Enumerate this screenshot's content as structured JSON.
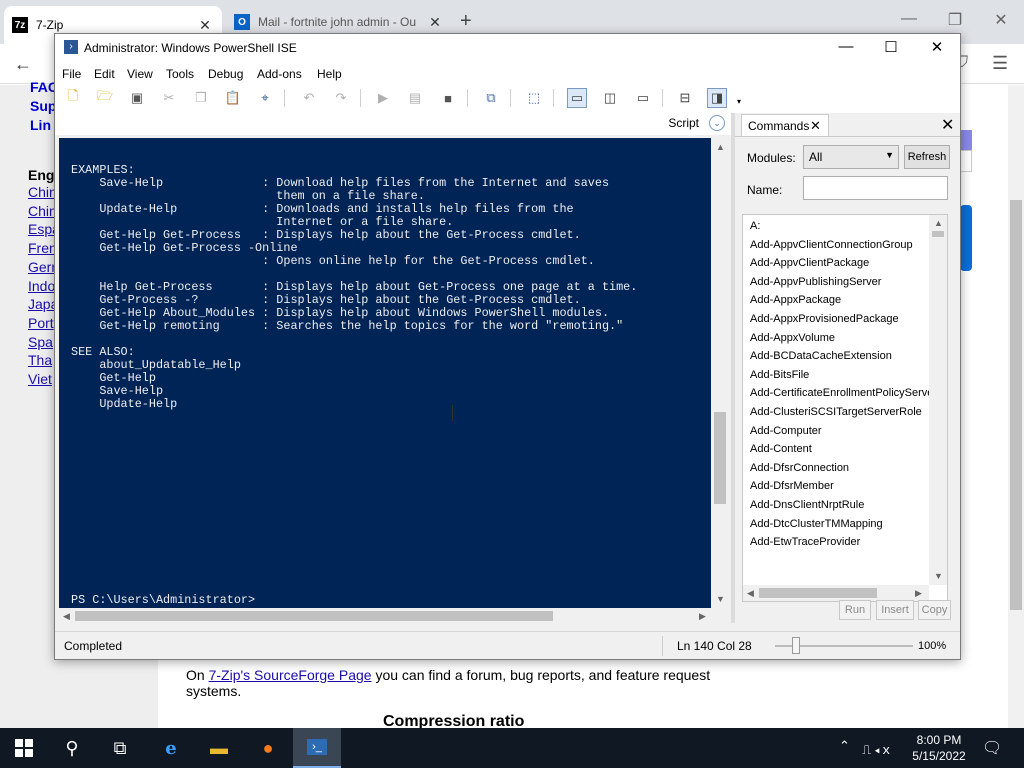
{
  "browser": {
    "tabs": [
      {
        "icon": "7z",
        "title": "7-Zip",
        "close": "✕"
      },
      {
        "icon": "O",
        "title": "Mail - fortnite john admin - Ou",
        "close": "✕"
      }
    ],
    "new_tab": "+",
    "window_controls": {
      "minimize": "—",
      "maximize": "❐",
      "close": "✕"
    }
  },
  "page": {
    "sidebar_links": [
      "FAC",
      "Sup",
      "Lin"
    ],
    "languages_heading": "Eng",
    "languages": [
      "Chin",
      "Chin",
      "Espa",
      "Fren",
      "Gern",
      "Indo",
      "Japa",
      "Port",
      "Spa",
      "Tha",
      "Viet"
    ],
    "paragraph_prefix": "On ",
    "paragraph_link": "7-Zip's SourceForge Page",
    "paragraph_suffix": " you can find a forum, bug reports, and feature request systems.",
    "heading": "Compression ratio"
  },
  "ise": {
    "title": "Administrator: Windows PowerShell ISE",
    "menu": [
      "File",
      "Edit",
      "View",
      "Tools",
      "Debug",
      "Add-ons",
      "Help"
    ],
    "script_label": "Script",
    "console_text": "EXAMPLES:\n    Save-Help              : Download help files from the Internet and saves\n                             them on a file share.\n    Update-Help            : Downloads and installs help files from the\n                             Internet or a file share.\n    Get-Help Get-Process   : Displays help about the Get-Process cmdlet.\n    Get-Help Get-Process -Online\n                           : Opens online help for the Get-Process cmdlet.\n\n    Help Get-Process       : Displays help about Get-Process one page at a time.\n    Get-Process -?         : Displays help about the Get-Process cmdlet.\n    Get-Help About_Modules : Displays help about Windows PowerShell modules.\n    Get-Help remoting      : Searches the help topics for the word \"remoting.\"\n\nSEE ALSO:\n    about_Updatable_Help\n    Get-Help\n    Save-Help\n    Update-Help",
    "prompt": "PS C:\\Users\\Administrator>",
    "status": "Completed",
    "position": "Ln 140  Col 28",
    "zoom": "100%",
    "zoom_level": 0.15
  },
  "commands": {
    "tab_label": "Commands",
    "modules_label": "Modules:",
    "modules_value": "All",
    "refresh_label": "Refresh",
    "name_label": "Name:",
    "name_value": "",
    "items": [
      "A:",
      "Add-AppvClientConnectionGroup",
      "Add-AppvClientPackage",
      "Add-AppvPublishingServer",
      "Add-AppxPackage",
      "Add-AppxProvisionedPackage",
      "Add-AppxVolume",
      "Add-BCDataCacheExtension",
      "Add-BitsFile",
      "Add-CertificateEnrollmentPolicyServe",
      "Add-ClusteriSCSITargetServerRole",
      "Add-Computer",
      "Add-Content",
      "Add-DfsrConnection",
      "Add-DfsrMember",
      "Add-DnsClientNrptRule",
      "Add-DtcClusterTMMapping",
      "Add-EtwTraceProvider"
    ],
    "run_label": "Run",
    "insert_label": "Insert",
    "copy_label": "Copy"
  },
  "taskbar": {
    "time": "8:00 PM",
    "date": "5/15/2022"
  }
}
